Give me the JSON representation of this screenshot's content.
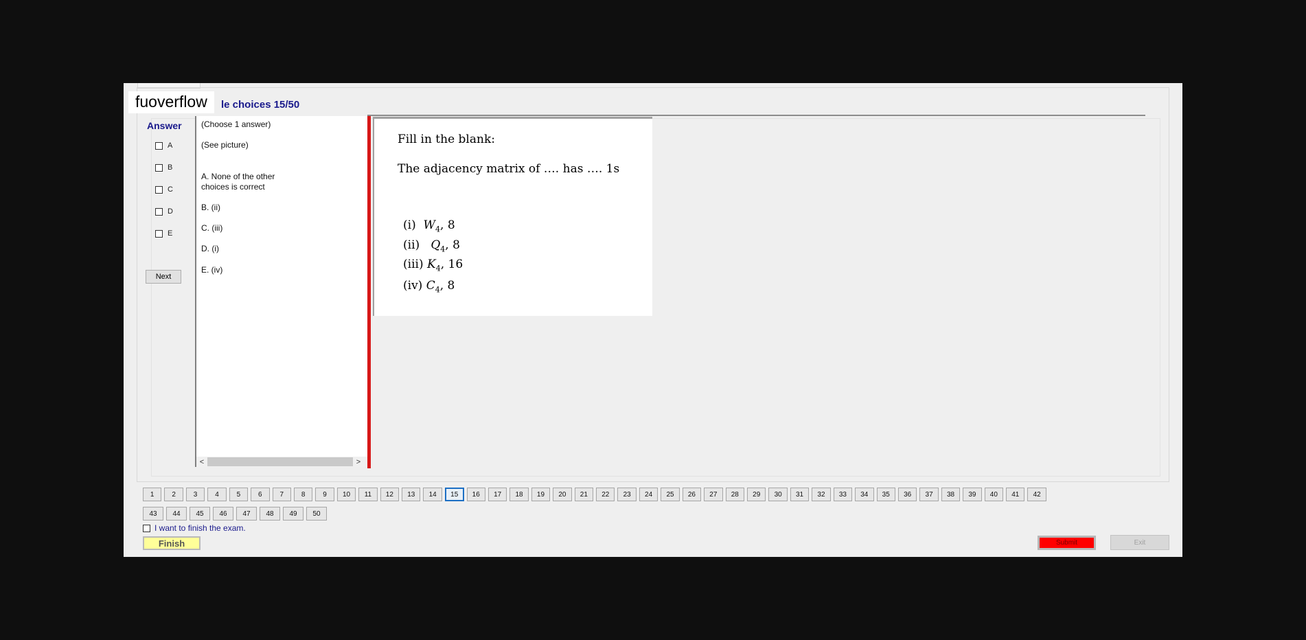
{
  "header": {
    "brand": "fuoverflow",
    "question_title": "le choices 15/50"
  },
  "answer_panel": {
    "label": "Answer",
    "options": [
      "A",
      "B",
      "C",
      "D",
      "E"
    ],
    "next_label": "Next"
  },
  "choices_list": {
    "instruction": "(Choose 1 answer)",
    "see_picture": "(See picture)",
    "items": [
      {
        "line1": "A.  None of the other",
        "line2": "choices is correct"
      },
      {
        "line1": "B.  (ii)"
      },
      {
        "line1": "C.  (iii)"
      },
      {
        "line1": "D.  (i)"
      },
      {
        "line1": "E.  (iv)"
      }
    ]
  },
  "question_picture": {
    "line1": "Fill in the blank:",
    "line2": "The adjacency matrix of …. has …. 1s",
    "items": [
      {
        "num": "(i)",
        "var": "W",
        "sub": "4",
        "val": "8"
      },
      {
        "num": "(ii)",
        "var": "Q",
        "sub": "4",
        "val": "8"
      },
      {
        "num": "(iii)",
        "var": "K",
        "sub": "4",
        "val": "16"
      },
      {
        "num": "(iv)",
        "var": "C",
        "sub": "4",
        "val": "8"
      }
    ]
  },
  "navigation": {
    "row1": [
      "1",
      "2",
      "3",
      "4",
      "5",
      "6",
      "7",
      "8",
      "9",
      "10",
      "11",
      "12",
      "13",
      "14",
      "15",
      "16",
      "17",
      "18",
      "19",
      "20",
      "21",
      "22",
      "23",
      "24",
      "25",
      "26",
      "27",
      "28",
      "29",
      "30",
      "31",
      "32",
      "33",
      "34",
      "35",
      "36",
      "37",
      "38",
      "39",
      "40",
      "41",
      "42"
    ],
    "row2": [
      "43",
      "44",
      "45",
      "46",
      "47",
      "48",
      "49",
      "50"
    ],
    "current": "15"
  },
  "footer": {
    "finish_checkbox_label": "I want to finish the exam.",
    "finish_label": "Finish",
    "submit_label": "Submit",
    "exit_label": "Exit"
  }
}
